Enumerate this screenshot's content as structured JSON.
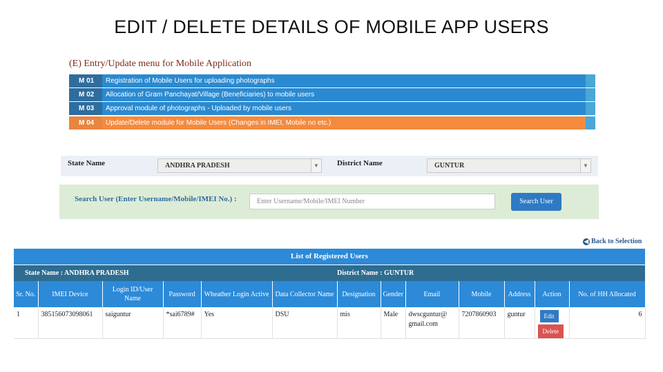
{
  "slide_title": "EDIT / DELETE DETAILS OF MOBILE APP USERS",
  "menu": {
    "header": "(E) Entry/Update menu for Mobile Application",
    "items": [
      {
        "code": "M 01",
        "label": "Registration of Mobile Users for uploading photographs"
      },
      {
        "code": "M 02",
        "label": "Allocation of Gram Panchayat/Village (Beneficiaries) to mobile users"
      },
      {
        "code": "M 03",
        "label": "Approval module of photographs - Uploaded by mobile users"
      },
      {
        "code": "M 04",
        "label": "Update/Delete module for Mobile Users (Changes in IMEI, Mobile no etc.)"
      }
    ]
  },
  "selection": {
    "state_label": "State Name",
    "state_value": "ANDHRA PRADESH",
    "district_label": "District Name",
    "district_value": "GUNTUR"
  },
  "search": {
    "label": "Search User (Enter Username/Mobile/IMEI No.) :",
    "placeholder": "Enter Username/Mobile/IMEI Number",
    "button": "Search User"
  },
  "back_link": "Back to Selection",
  "table": {
    "title": "List of Registered Users",
    "state_text": "State Name : ANDHRA PRADESH",
    "district_text": "District Name : GUNTUR",
    "columns": [
      "Sr. No.",
      "IMEI Device",
      "Login ID/User Name",
      "Password",
      "Wheather Login Active",
      "Data Collector Name",
      "Designation",
      "Gender",
      "Email",
      "Mobile",
      "Address",
      "Action",
      "No. of HH Allocated"
    ],
    "rows": [
      {
        "sr": "1",
        "imei": "385156073098061",
        "login": "saiguntur",
        "password": "*sai6789#",
        "active": "Yes",
        "collector": "DSU",
        "designation": "mis",
        "gender": "Male",
        "email": "dwscguntur@ gmail.com",
        "mobile": "7207860903",
        "address": "guntur",
        "edit": "Edit",
        "delete": "Delete",
        "hh": "6"
      }
    ]
  }
}
